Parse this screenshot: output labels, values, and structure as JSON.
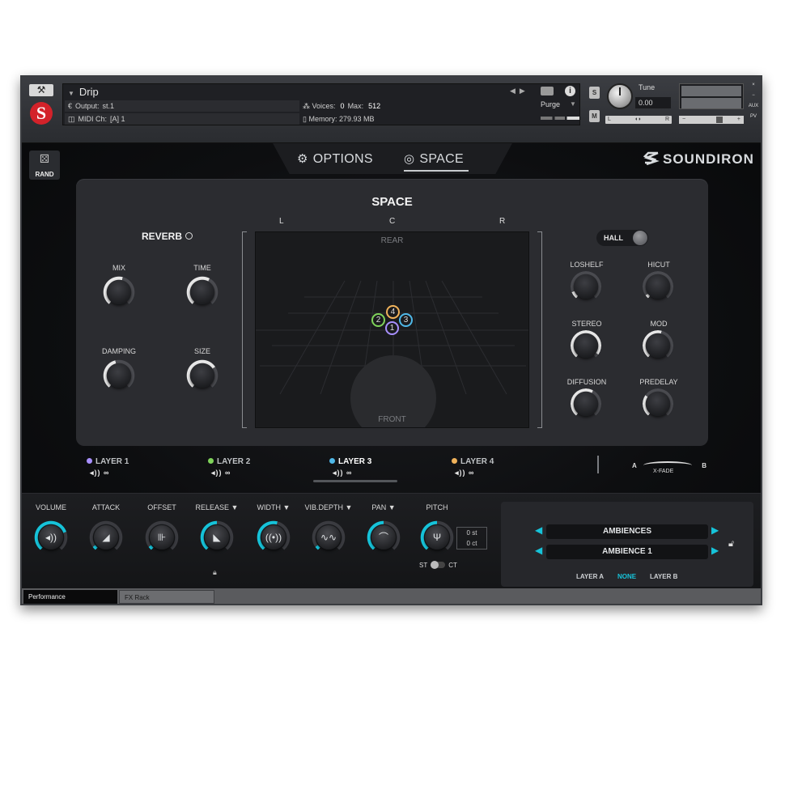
{
  "header": {
    "instrument_name": "Drip",
    "output_label": "Output:",
    "output_value": "st.1",
    "voices_label": "Voices:",
    "voices_value": "0",
    "max_label": "Max:",
    "max_value": "512",
    "midi_label": "MIDI Ch:",
    "midi_value": "[A]  1",
    "memory_label": "Memory:",
    "memory_value": "279.93 MB",
    "purge_label": "Purge",
    "solo_label": "S",
    "mute_label": "M",
    "tune_label": "Tune",
    "tune_value": "0.00",
    "pan_left": "L",
    "pan_right": "R",
    "vol_minus": "−",
    "vol_plus": "+",
    "side_close": "×",
    "side_min": "−",
    "side_aux": "AUX",
    "side_pv": "PV"
  },
  "rand_label": "RAND",
  "tabs": {
    "options": "OPTIONS",
    "space": "SPACE"
  },
  "brand": "SOUNDIRON",
  "space_panel": {
    "title": "SPACE",
    "left": "L",
    "center": "C",
    "right": "R",
    "rear": "REAR",
    "front": "FRONT",
    "reverb_title": "REVERB",
    "hall_label": "HALL",
    "reverb_knobs": [
      {
        "label": "MIX",
        "value": 0.55
      },
      {
        "label": "TIME",
        "value": 0.6
      },
      {
        "label": "DAMPING",
        "value": 0.45
      },
      {
        "label": "SIZE",
        "value": 0.7
      }
    ],
    "right_knobs": [
      {
        "label": "LOSHELF",
        "value": 0.1
      },
      {
        "label": "HICUT",
        "value": 0.05
      },
      {
        "label": "STEREO",
        "value": 0.95
      },
      {
        "label": "MOD",
        "value": 0.55
      },
      {
        "label": "DIFFUSION",
        "value": 0.6
      },
      {
        "label": "PREDELAY",
        "value": 0.3
      }
    ],
    "layer_markers": [
      "1",
      "2",
      "3",
      "4"
    ]
  },
  "layers": [
    {
      "label": "LAYER 1",
      "color": "#a890ff"
    },
    {
      "label": "LAYER 2",
      "color": "#7fd35a"
    },
    {
      "label": "LAYER 3",
      "color": "#4fb8e8"
    },
    {
      "label": "LAYER 4",
      "color": "#f0b25a"
    }
  ],
  "xfade": {
    "a": "A",
    "b": "B",
    "label": "X-FADE"
  },
  "controls": [
    {
      "label": "VOLUME",
      "icon": "speaker-icon",
      "value": 0.75
    },
    {
      "label": "ATTACK",
      "icon": "ramp-up-icon",
      "value": 0.05
    },
    {
      "label": "OFFSET",
      "icon": "play-icon",
      "value": 0.05
    },
    {
      "label": "RELEASE ▼",
      "icon": "ramp-down-icon",
      "value": 0.5
    },
    {
      "label": "WIDTH ▼",
      "icon": "stereo-width-icon",
      "value": 0.55
    },
    {
      "label": "VIB.DEPTH ▼",
      "icon": "wave-icon",
      "value": 0.05
    },
    {
      "label": "PAN ▼",
      "icon": "pan-arc-icon",
      "value": 0.5
    },
    {
      "label": "PITCH",
      "icon": "tuning-fork-icon",
      "value": 0.5
    }
  ],
  "pitch": {
    "semitones": "0 st",
    "cents": "0 ct",
    "st_label": "ST",
    "ct_label": "CT"
  },
  "ambience": {
    "row1": "AMBIENCES",
    "row2": "AMBIENCE 1",
    "layer_a": "LAYER A",
    "none": "NONE",
    "layer_b": "LAYER B"
  },
  "status_tabs": {
    "performance": "Performance",
    "fx_rack": "FX Rack"
  },
  "colors": {
    "accent": "#16c3d9",
    "brand_red": "#d3222a"
  }
}
